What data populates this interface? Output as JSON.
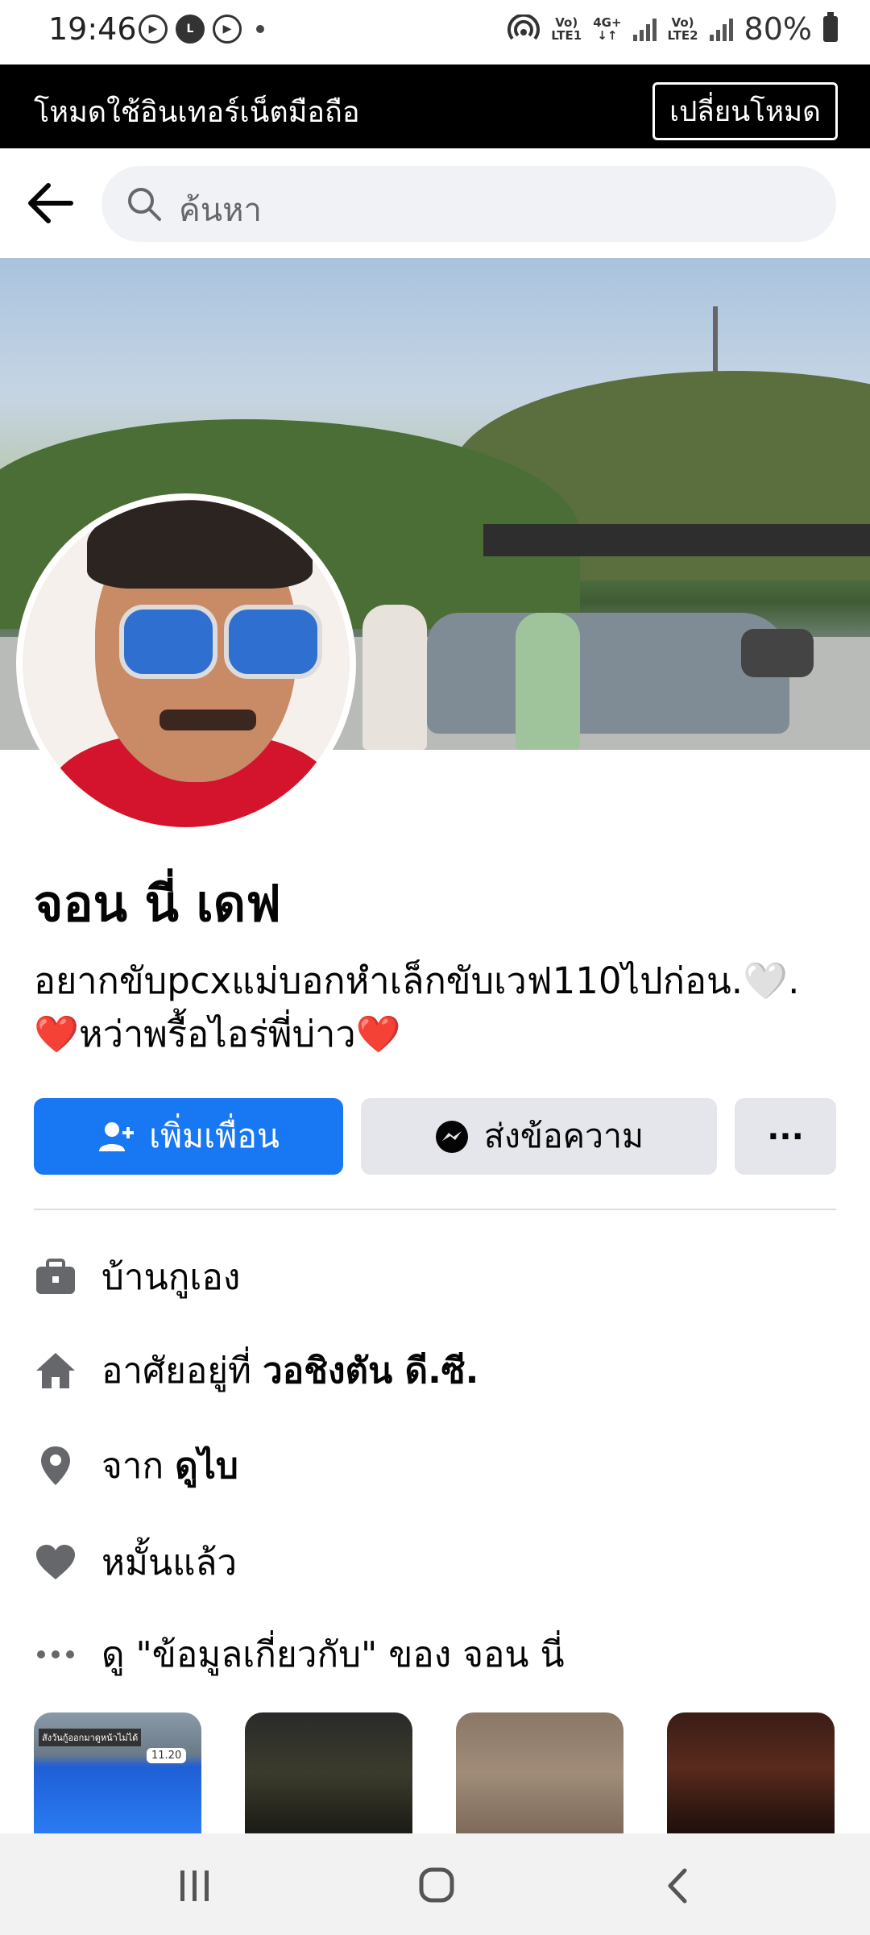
{
  "status_bar": {
    "time": "19:46",
    "right_label_1_top": "Vo)",
    "right_label_1_bottom": "LTE1",
    "right_label_2_top": "4G+",
    "right_label_2_bottom": "↓↑",
    "right_label_3_top": "Vo)",
    "right_label_3_bottom": "LTE2",
    "battery": "80%"
  },
  "banner": {
    "text": "โหมดใช้อินเทอร์เน็ตมือถือ",
    "button": "เปลี่ยนโหมด"
  },
  "header": {
    "search_placeholder": "ค้นหา"
  },
  "profile": {
    "name": "จอน นี่ เดฟ",
    "bio_line1": "อยากขับpcxแม่บอกหำเล็กขับเวฟ110ไปก่อน.🤍.",
    "bio_line2": "❤️หว่าพรื้อไอร่พี่บ่าว❤️"
  },
  "actions": {
    "add_friend": "เพิ่มเพื่อน",
    "message": "ส่งข้อความ",
    "more": "···"
  },
  "info": {
    "work": "บ้านกูเอง",
    "lives_prefix": "อาศัยอยู่ที่ ",
    "lives_place": "วอชิงตัน ดี.ซี.",
    "from_prefix": "จาก ",
    "from_place": "ดูไบ",
    "relationship": "หมั้นแล้ว",
    "see_about": "ดู \"ข้อมูลเกี่ยวกับ\" ของ จอน นี่"
  },
  "thumbnails": {
    "t1_caption": "สังวันกู้ออกมาดูหน้าไม่ได้",
    "t1_badge": "11.20"
  },
  "colors": {
    "primary": "#1877f2",
    "button_gray": "#e4e6eb",
    "icon_gray": "#65676b"
  }
}
